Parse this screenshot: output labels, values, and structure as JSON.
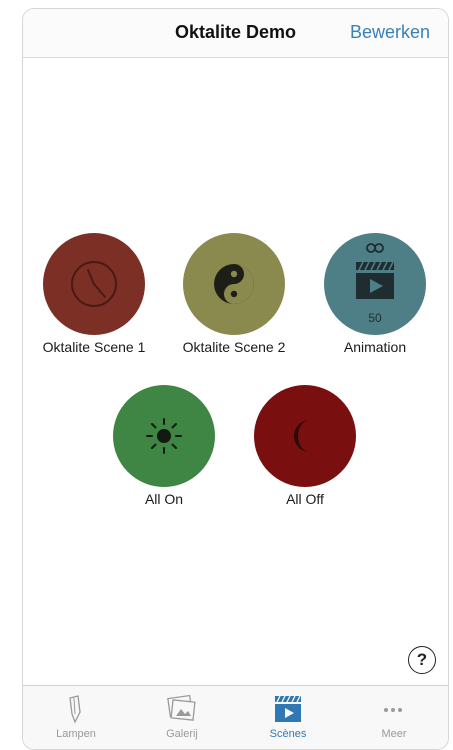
{
  "header": {
    "title": "Oktalite Demo",
    "edit_label": "Bewerken"
  },
  "scenes": [
    {
      "label": "Oktalite Scene 1",
      "color": "#7b2f25",
      "icon": "clock-icon"
    },
    {
      "label": "Oktalite Scene 2",
      "color": "#8a8a4f",
      "icon": "yin-yang-icon"
    },
    {
      "label": "Animation",
      "color": "#4e7f86",
      "icon": "clapperboard-icon",
      "count": "50"
    },
    {
      "label": "All On",
      "color": "#3f8543",
      "icon": "sun-icon"
    },
    {
      "label": "All Off",
      "color": "#7a0f10",
      "icon": "moon-icon"
    }
  ],
  "help": {
    "symbol": "?"
  },
  "tabbar": {
    "tabs": [
      {
        "label": "Lampen",
        "icon": "lamp-icon",
        "active": false
      },
      {
        "label": "Galerij",
        "icon": "gallery-icon",
        "active": false
      },
      {
        "label": "Scènes",
        "icon": "clapperboard-icon",
        "active": true
      },
      {
        "label": "Meer",
        "icon": "more-icon",
        "active": false
      }
    ]
  },
  "colors": {
    "accent": "#2f78b4",
    "link": "#3a7fb9"
  }
}
